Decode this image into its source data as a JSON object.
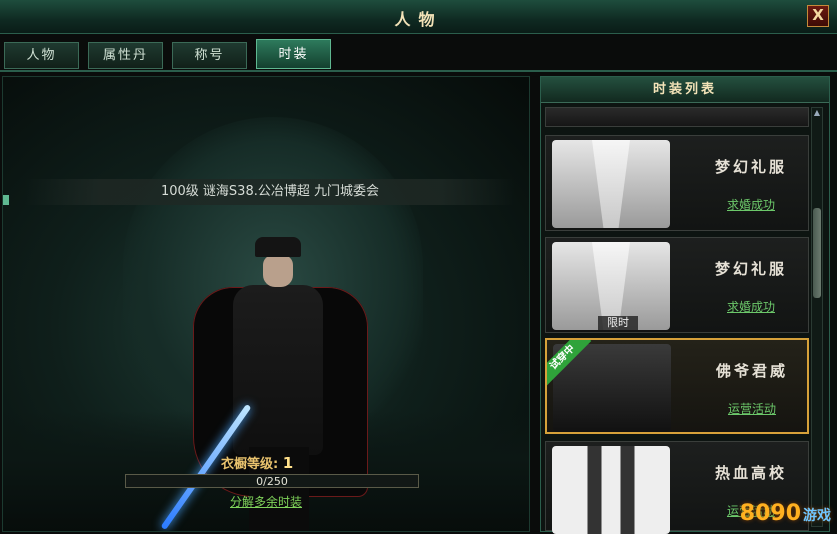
{
  "window": {
    "title": "人物",
    "close": "X"
  },
  "tabs": [
    {
      "label": "人物"
    },
    {
      "label": "属性丹"
    },
    {
      "label": "称号"
    },
    {
      "label": "时装"
    }
  ],
  "character": {
    "info": "100级    谜海S38.公冶博超    九门城委会",
    "wardrobe_label": "衣橱等级:",
    "wardrobe_level": "1",
    "progress_text": "0/250",
    "progress_fraction": 0,
    "decompose_link": "分解多余时装"
  },
  "fashion_list": {
    "title": "时装列表",
    "items": [
      {
        "name": "梦幻礼服",
        "link": "求婚成功",
        "badge": ""
      },
      {
        "name": "梦幻礼服",
        "link": "求婚成功",
        "badge": "限时"
      },
      {
        "name": "佛爷君威",
        "link": "运营活动",
        "badge": "试穿中"
      },
      {
        "name": "热血高校",
        "link": "运营活动",
        "badge": ""
      }
    ]
  },
  "watermark": {
    "main": "8090",
    "sub": "游戏"
  }
}
